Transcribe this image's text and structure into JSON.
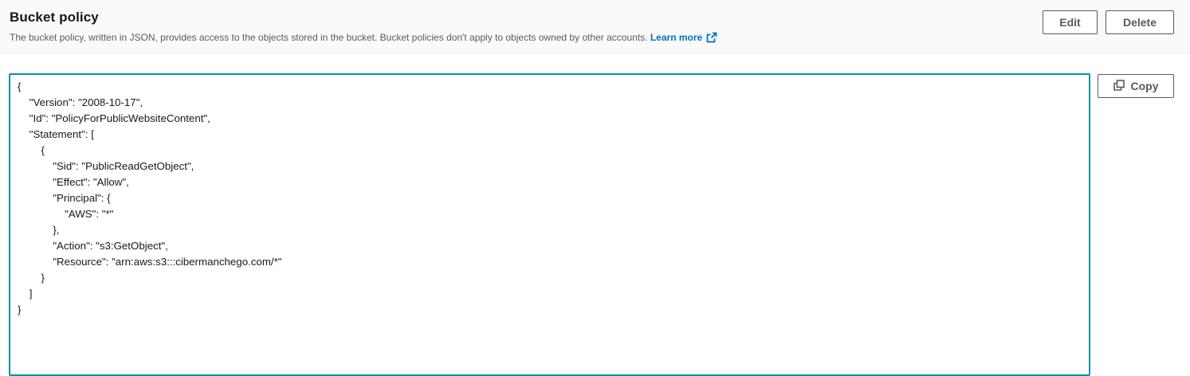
{
  "header": {
    "title": "Bucket policy",
    "description": "The bucket policy, written in JSON, provides access to the objects stored in the bucket. Bucket policies don't apply to objects owned by other accounts.",
    "learn_more": "Learn more"
  },
  "actions": {
    "edit_label": "Edit",
    "delete_label": "Delete",
    "copy_label": "Copy"
  },
  "editor": {
    "content": "{\n    \"Version\": \"2008-10-17\",\n    \"Id\": \"PolicyForPublicWebsiteContent\",\n    \"Statement\": [\n        {\n            \"Sid\": \"PublicReadGetObject\",\n            \"Effect\": \"Allow\",\n            \"Principal\": {\n                \"AWS\": \"*\"\n            },\n            \"Action\": \"s3:GetObject\",\n            \"Resource\": \"arn:aws:s3:::cibermanchego.com/*\"\n        }\n    ]\n}"
  },
  "colors": {
    "accent_link": "#0073bb",
    "editor_border": "#0a8fa8",
    "text_primary": "#16191f",
    "text_secondary": "#545b64"
  },
  "icons": {
    "external_link": "external-link-icon",
    "copy": "copy-icon"
  }
}
